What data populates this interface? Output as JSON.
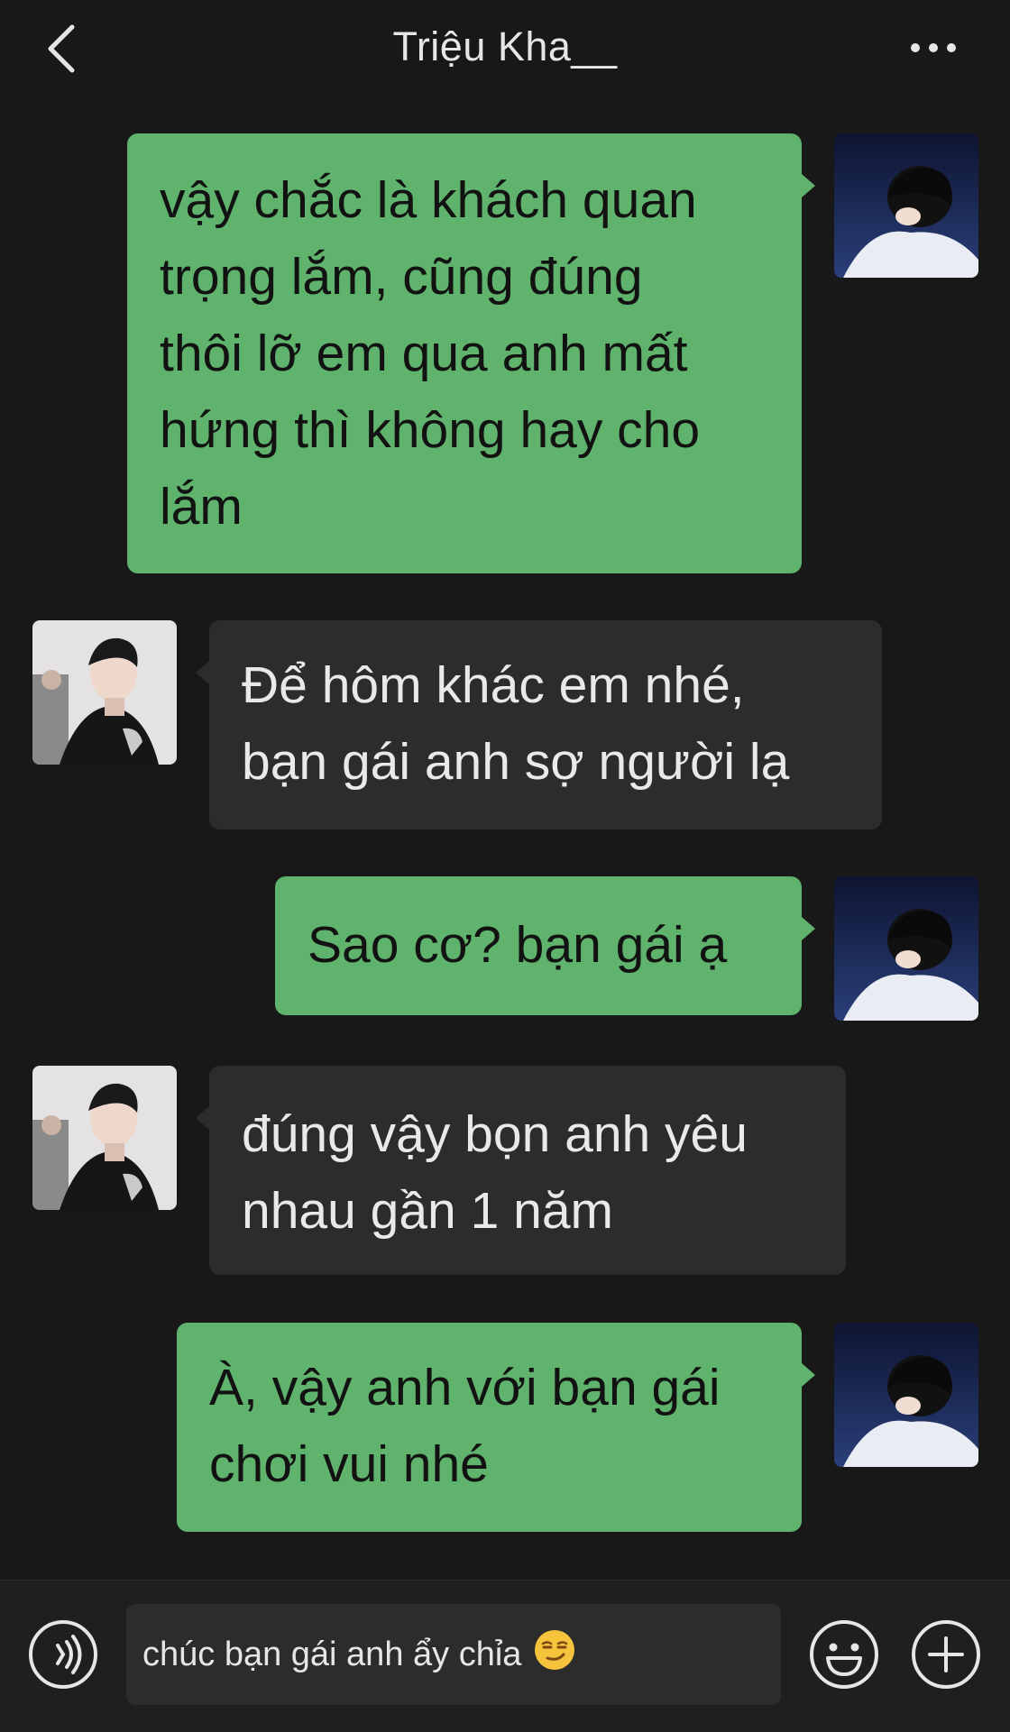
{
  "header": {
    "title": "Triệu Kha__",
    "back_icon": "chevron-left-icon",
    "more_icon": "more-horizontal-icon"
  },
  "messages": [
    {
      "side": "out",
      "lines": [
        "vậy chắc là khách quan",
        "trọng lắm, cũng đúng",
        "thôi lỡ em qua anh mất",
        "hứng thì không hay cho",
        "lắm"
      ]
    },
    {
      "side": "in",
      "lines": [
        "Để hôm khác em nhé,",
        "bạn gái anh sợ người lạ"
      ]
    },
    {
      "side": "out",
      "lines": [
        "Sao cơ? bạn gái ạ"
      ]
    },
    {
      "side": "in",
      "lines": [
        "đúng vậy bọn anh yêu",
        "nhau gần 1 năm"
      ]
    },
    {
      "side": "out",
      "lines": [
        "À, vậy anh với bạn gái",
        "chơi vui nhé"
      ]
    }
  ],
  "input": {
    "value": "chúc bạn gái anh ẩy chỉa",
    "emoji": "smirk-emoji",
    "voice_icon": "voice-icon",
    "sticker_icon": "emoji-icon",
    "plus_icon": "plus-icon"
  },
  "colors": {
    "background": "#181818",
    "outgoing_bubble": "#5fb36d",
    "incoming_bubble": "#2c2c2c",
    "input_bar": "#1f1f1f"
  }
}
